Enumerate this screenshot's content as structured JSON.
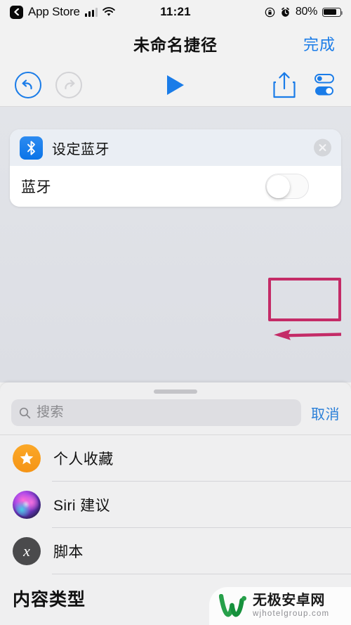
{
  "status_bar": {
    "back_label": "App Store",
    "back_icon": "chevron-left-icon",
    "signal_icon": "cellular-signal-icon",
    "wifi_icon": "wifi-icon",
    "time": "11:21",
    "rotation_lock_icon": "rotation-lock-icon",
    "alarm_icon": "alarm-clock-icon",
    "battery_percent": "80%",
    "battery_icon": "battery-icon"
  },
  "nav_bar": {
    "title": "未命名捷径",
    "done_label": "完成"
  },
  "toolbar": {
    "undo_icon": "undo-arrow-icon",
    "redo_icon": "redo-arrow-icon",
    "play_icon": "play-triangle-icon",
    "share_icon": "share-upload-icon",
    "settings_icon": "settings-toggles-icon"
  },
  "action_card": {
    "app_icon": "bluetooth-icon",
    "title": "设定蓝牙",
    "close_icon": "close-circle-icon",
    "row_label": "蓝牙",
    "toggle_state": "off"
  },
  "annotation": {
    "highlight_color": "#C42B67",
    "arrow_icon": "left-arrow-annotation",
    "target": "蓝牙 toggle"
  },
  "bottom_sheet": {
    "handle_icon": "drag-handle",
    "search": {
      "icon": "search-icon",
      "value": "",
      "placeholder": "搜索"
    },
    "cancel_label": "取消",
    "items": [
      {
        "label": "个人收藏",
        "icon": "star-icon",
        "icon_color": "#F59415"
      },
      {
        "label": "Siri 建议",
        "icon": "siri-orb-icon",
        "icon_color": "#B14BE8"
      },
      {
        "label": "脚本",
        "icon": "script-x-icon",
        "icon_color": "#4A4A4C"
      }
    ],
    "section_header": "内容类型"
  },
  "watermark": {
    "logo_icon": "w-logo-icon",
    "name": "无极安卓网",
    "url": "wjhotelgroup.com",
    "color": "#27A04A"
  }
}
